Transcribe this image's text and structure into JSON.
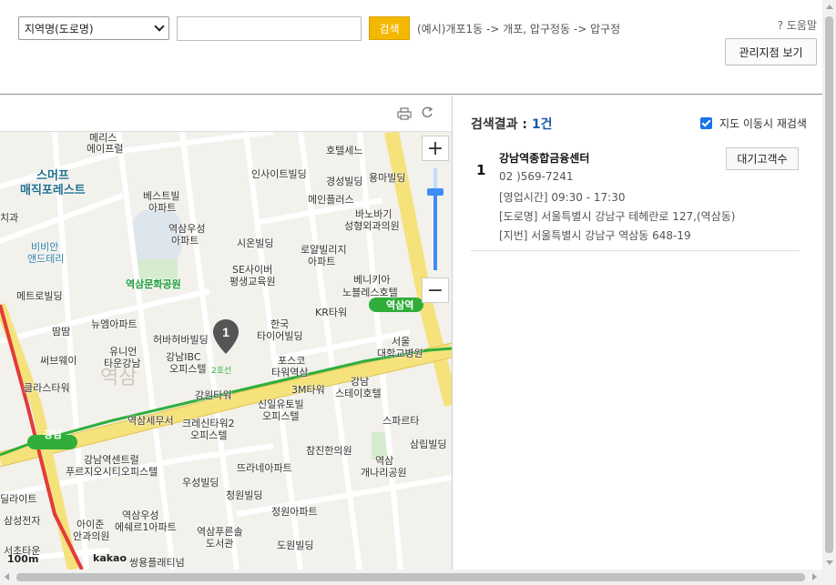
{
  "search": {
    "region_selected": "지역명(도로명)",
    "query_value": "",
    "button_label": "검색",
    "example_hint": "(예시)개포1동 -> 개포, 압구정동 -> 압구정",
    "help_label": "? 도움말",
    "branch_button_label": "관리지점 보기"
  },
  "results": {
    "title_prefix": "검색결과 : ",
    "count": "1건",
    "recheck_label": "지도 이동시 재검색",
    "recheck_checked": true,
    "items": [
      {
        "num": "1",
        "name": "강남역종합금융센터",
        "phone": "02 )569-7241",
        "hours": "[영업시간] 09:30 - 17:30",
        "road_address": "[도로명] 서울특별시 강남구 테헤란로 127,(역삼동)",
        "lot_address": "[지번] 서울특별시 강남구 역삼동 648-19",
        "wait_button_label": "대기고객수"
      }
    ]
  },
  "map": {
    "scale_label": "100m",
    "provider_label": "kakao",
    "marker_label": "1",
    "labels": {
      "l01": "메리스",
      "l02": "에이프럴",
      "l03": "스머프",
      "l04": "매직포레스트",
      "l05": "베스트빌",
      "l06": "아파트",
      "l07": "역삼우성",
      "l08": "아파트",
      "l09": "인사이트빌딩",
      "l10": "경성빌딩",
      "l11": "용마빌딩",
      "l12": "호텔세느",
      "l13": "메인플러스",
      "l14": "바노바기",
      "l15": "성형외과의원",
      "l16": "시온빌딩",
      "l17": "로얄빌리지",
      "l18": "아파트",
      "l19": "SE사이버",
      "l20": "평생교육원",
      "l21": "역삼문화공원",
      "l22": "베니키아",
      "l23": "노블레스호텔",
      "l24": "비비안",
      "l25": "앤드테리",
      "l26": "메트로빌딩",
      "l27": "뉴엠아파트",
      "l28": "땀땀",
      "l29": "허바허바빌딩",
      "l30": "한국",
      "l31": "타이어빌딩",
      "l32": "KR타워",
      "l33": "유니언",
      "l34": "타운강남",
      "l35": "써브웨이",
      "l36": "강남IBC",
      "l37": "오피스텔",
      "l38": "포스코",
      "l39": "타워역삼",
      "l40": "서울",
      "l41": "대학교병원",
      "l42": "클라스타워",
      "l43": "강남",
      "l44": "스테이호텔",
      "l45": "3M타워",
      "l46": "강원타워",
      "l47": "신일유토빌",
      "l48": "오피스텔",
      "l49": "역삼세무서",
      "l50": "크레신타워2",
      "l51": "오피스텔",
      "l52": "스파르타",
      "l53": "삼립빌딩",
      "l54": "참진한의원",
      "l55": "강남역센트럴",
      "l56": "푸르지오시티오피스텔",
      "l57": "뜨라네아파트",
      "l58": "역삼",
      "l59": "개나리공원",
      "l60": "우성빌딩",
      "l61": "청원빌딩",
      "l62": "정원아파트",
      "l63": "역삼우성",
      "l64": "에쉐르1아파트",
      "l65": "아이준",
      "l66": "안과의원",
      "l67": "역삼푸른솔",
      "l68": "도서관",
      "l69": "도원빌딩",
      "l70": "삼성전자",
      "l71": "딜라이트",
      "l72": "서초타운",
      "l73": "쌍용플래티넘",
      "l74": "역삼",
      "l75": "강남",
      "l76": "역삼역",
      "l77": "치과",
      "l78": "2호선"
    }
  }
}
